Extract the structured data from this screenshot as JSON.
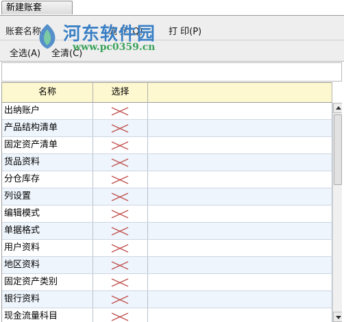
{
  "tab": {
    "label": "新建账套"
  },
  "toolbar": {
    "name_label": "账套名称:",
    "confirm_label": "确 定(Q)",
    "print_label": "打 印(P)",
    "select_all_label": "全选(A)",
    "clear_all_label": "全清(C)"
  },
  "watermark": {
    "title": "河东软件园",
    "url": "www.pc0359.cn"
  },
  "grid": {
    "columns": [
      "名称",
      "选择",
      ""
    ],
    "rows": [
      {
        "name": "出纳账户",
        "selected": false
      },
      {
        "name": "产品结构清单",
        "selected": false
      },
      {
        "name": "固定资产清单",
        "selected": false
      },
      {
        "name": "货品资料",
        "selected": false
      },
      {
        "name": "分仓库存",
        "selected": false
      },
      {
        "name": "列设置",
        "selected": false
      },
      {
        "name": "编辑模式",
        "selected": false
      },
      {
        "name": "单据格式",
        "selected": false
      },
      {
        "name": "用户资料",
        "selected": false
      },
      {
        "name": "地区资料",
        "selected": false
      },
      {
        "name": "固定资产类别",
        "selected": false
      },
      {
        "name": "银行资料",
        "selected": false
      },
      {
        "name": "现金流量科目",
        "selected": false
      }
    ]
  },
  "colors": {
    "header_bg": "#fdf8cf",
    "alt_row_bg": "#eef5fc",
    "xmark": "#c0504d",
    "toolbar_bg": "#eeeeee"
  },
  "icons": {
    "unchecked": "red-x-icon"
  }
}
